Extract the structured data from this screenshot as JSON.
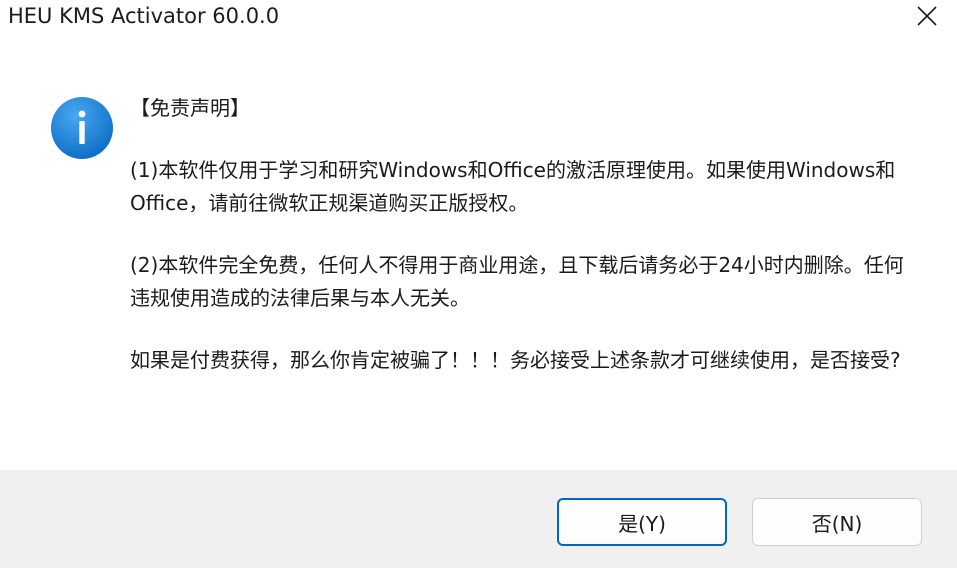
{
  "window": {
    "title": "HEU KMS Activator 60.0.0"
  },
  "dialog": {
    "icon": "info-icon",
    "heading": "【免责声明】",
    "paragraph1": "(1)本软件仅用于学习和研究Windows和Office的激活原理使用。如果使用Windows和Office，请前往微软正规渠道购买正版授权。",
    "paragraph2": "(2)本软件完全免费，任何人不得用于商业用途，且下载后请务必于24小时内删除。任何违规使用造成的法律后果与本人无关。",
    "paragraph3": "如果是付费获得，那么你肯定被骗了！！！务必接受上述条款才可继续使用，是否接受?"
  },
  "buttons": {
    "yes_label": "是(Y)",
    "no_label": "否(N)"
  },
  "colors": {
    "accent": "#0067c0",
    "icon_blue": "#1a7fd4",
    "footer_bg": "#f0f0f0"
  }
}
